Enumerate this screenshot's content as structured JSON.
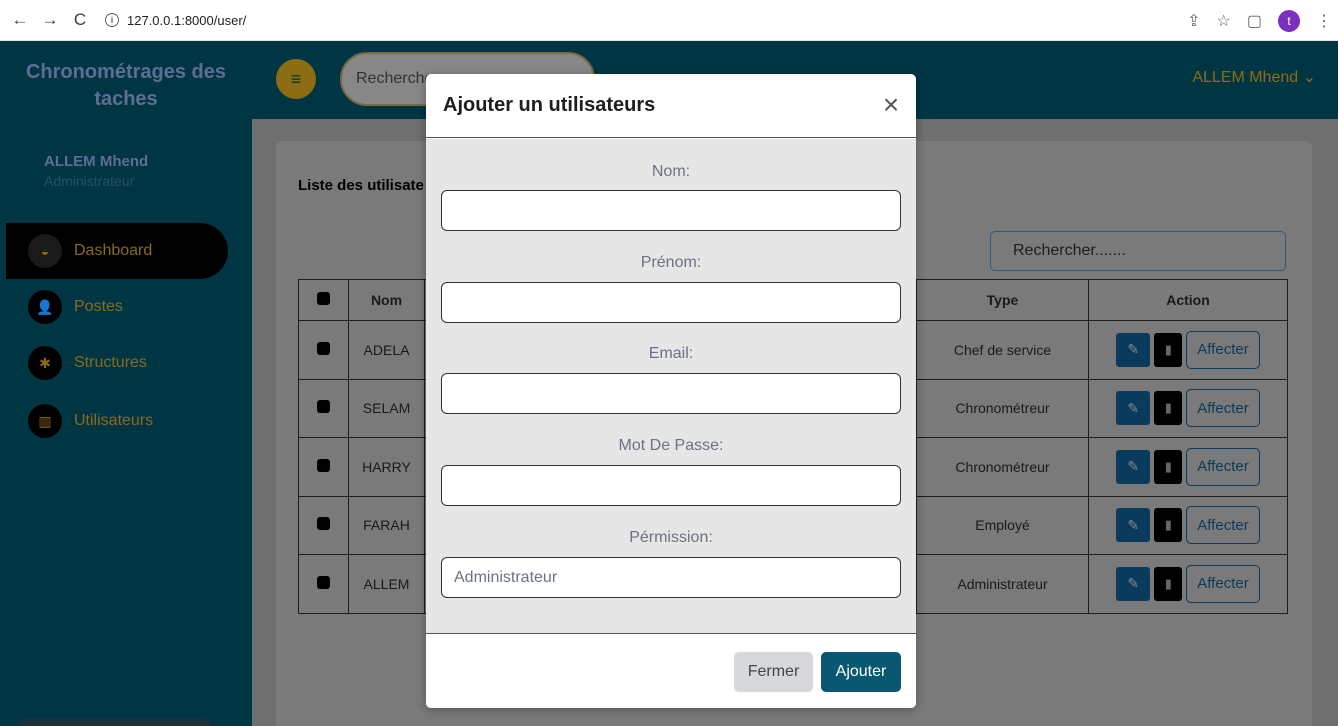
{
  "browser": {
    "back_icon": "←",
    "forward_icon": "→",
    "reload_icon": "C",
    "url": "127.0.0.1:8000/user/",
    "profile_initial": "t"
  },
  "sidebar": {
    "title_line1": "Chronométrages des",
    "title_line2": "taches",
    "user_name": "ALLEM Mhend",
    "user_role": "Administrateur",
    "items": [
      {
        "label": "Dashboard",
        "icon": "◒"
      },
      {
        "label": "Postes",
        "icon": "👤"
      },
      {
        "label": "Structures",
        "icon": "✱"
      },
      {
        "label": "Utilisateurs",
        "icon": "▥"
      }
    ]
  },
  "topbar": {
    "menu_icon": "≡",
    "search_placeholder": "Recherche",
    "user_label": "ALLEM Mhend ⌄"
  },
  "card": {
    "title": "Liste des utilisate",
    "search_placeholder": "Rechercher.......",
    "columns": [
      "Nom",
      "Type",
      "Action"
    ],
    "rows": [
      {
        "nom": "ADELA",
        "type": "Chef de service",
        "action": "Affecter"
      },
      {
        "nom": "SELAM",
        "type": "Chronométreur",
        "action": "Affecter"
      },
      {
        "nom": "HARRY",
        "type": "Chronométreur",
        "action": "Affecter"
      },
      {
        "nom": "FARAH",
        "type": "Employé",
        "action": "Affecter"
      },
      {
        "nom": "ALLEM",
        "type": "Administrateur",
        "action": "Affecter"
      }
    ]
  },
  "modal": {
    "title": "Ajouter un utilisateurs",
    "close_icon": "×",
    "fields": [
      {
        "label": "Nom:",
        "value": ""
      },
      {
        "label": "Prénom:",
        "value": ""
      },
      {
        "label": "Email:",
        "value": ""
      },
      {
        "label": "Mot De Passe:",
        "value": ""
      },
      {
        "label": "Pérmission:",
        "value": "Administrateur"
      }
    ],
    "close_label": "Fermer",
    "submit_label": "Ajouter"
  }
}
